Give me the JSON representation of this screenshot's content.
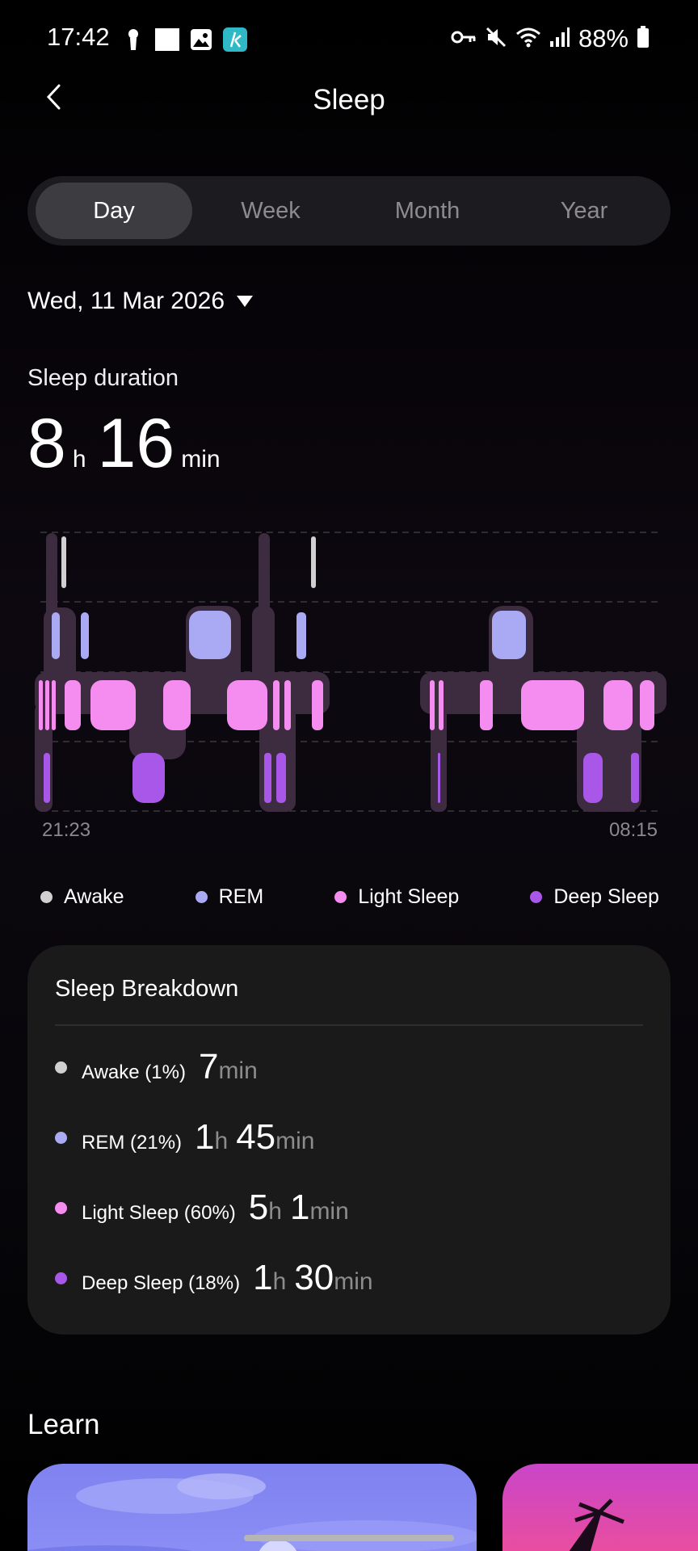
{
  "status_bar": {
    "time": "17:42",
    "battery": "88%",
    "left_icons": [
      "keyhole-icon",
      "square-icon",
      "gallery-icon",
      "app-k-icon"
    ],
    "right_icons": [
      "key-icon",
      "mute-icon",
      "wifi-icon",
      "signal-icon",
      "battery-icon"
    ]
  },
  "header": {
    "title": "Sleep",
    "back_icon": "chevron-left-icon"
  },
  "tabs": [
    {
      "label": "Day",
      "active": true
    },
    {
      "label": "Week",
      "active": false
    },
    {
      "label": "Month",
      "active": false
    },
    {
      "label": "Year",
      "active": false
    }
  ],
  "date": {
    "label": "Wed, 11 Mar 2026",
    "icon": "triangle-down-icon"
  },
  "duration": {
    "label": "Sleep duration",
    "hours": "8",
    "hours_unit": "h",
    "minutes": "16",
    "minutes_unit": "min"
  },
  "chart": {
    "start_time": "21:23",
    "end_time": "08:15"
  },
  "legend": [
    {
      "label": "Awake",
      "color": "#d0d0d0"
    },
    {
      "label": "REM",
      "color": "#a9aaf3"
    },
    {
      "label": "Light Sleep",
      "color": "#f58cf0"
    },
    {
      "label": "Deep Sleep",
      "color": "#a957e8"
    }
  ],
  "breakdown": {
    "title": "Sleep Breakdown",
    "rows": [
      {
        "label": "Awake (1%)",
        "color": "#d0d0d0",
        "n1": "",
        "u1": "",
        "n2": "7",
        "u2": "min"
      },
      {
        "label": "REM (21%)",
        "color": "#a9aaf3",
        "n1": "1",
        "u1": "h",
        "n2": "45",
        "u2": "min"
      },
      {
        "label": "Light Sleep (60%)",
        "color": "#f58cf0",
        "n1": "5",
        "u1": "h",
        "n2": "1",
        "u2": "min"
      },
      {
        "label": "Deep Sleep (18%)",
        "color": "#a957e8",
        "n1": "1",
        "u1": "h",
        "n2": "30",
        "u2": "min"
      }
    ]
  },
  "learn": {
    "title": "Learn"
  }
}
